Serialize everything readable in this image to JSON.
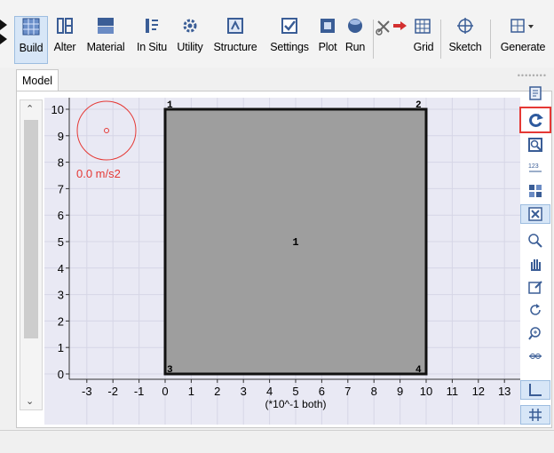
{
  "toolbar": {
    "items": [
      {
        "label": "Build",
        "icon": "build-grid-icon"
      },
      {
        "label": "Alter",
        "icon": "alter-icon"
      },
      {
        "label": "Material",
        "icon": "material-icon"
      },
      {
        "label": "In Situ",
        "icon": "in-situ-icon"
      },
      {
        "label": "Utility",
        "icon": "utility-gear-icon"
      },
      {
        "label": "Structure",
        "icon": "structure-icon"
      },
      {
        "label": "Settings",
        "icon": "settings-checkbox-icon"
      },
      {
        "label": "Plot",
        "icon": "plot-icon"
      },
      {
        "label": "Run",
        "icon": "run-sphere-icon"
      },
      {
        "label": "Grid",
        "icon": "grid-icon"
      },
      {
        "label": "Sketch",
        "icon": "sketch-crosshair-icon"
      },
      {
        "label": "Generate",
        "icon": "generate-icon"
      }
    ]
  },
  "tabs": {
    "model": "Model"
  },
  "view": {
    "gravity_label": "0.0 m/s2",
    "zone_label": "1",
    "corner_labels": {
      "top_left": "1",
      "top_right": "2",
      "bottom_left": "3",
      "bottom_right": "4"
    },
    "x_ticks": [
      "-3",
      "-2",
      "-1",
      "0",
      "1",
      "2",
      "3",
      "4",
      "5",
      "6",
      "7",
      "8",
      "9",
      "10",
      "11",
      "12",
      "13"
    ],
    "y_ticks": [
      "0",
      "1",
      "2",
      "3",
      "4",
      "5",
      "6",
      "7",
      "8",
      "9",
      "10"
    ],
    "axis_scale_label": "(*10^-1 both)"
  },
  "colors": {
    "gravity": "#e53935",
    "block_fill": "#9e9e9e",
    "plot_bg": "#e9e9f4",
    "highlight": "#e53935"
  }
}
